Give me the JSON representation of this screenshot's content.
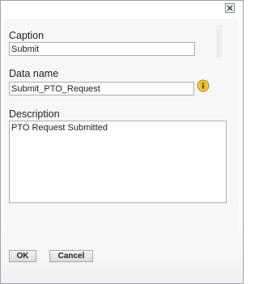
{
  "dialog": {
    "caption": {
      "label": "Caption",
      "value": "Submit"
    },
    "data_name": {
      "label": "Data name",
      "value": "Submit_PTO_Request",
      "info_icon": "info-icon"
    },
    "description": {
      "label": "Description",
      "value": "PTO Request Submitted"
    },
    "buttons": {
      "ok": "OK",
      "cancel": "Cancel"
    },
    "close_icon": "close-icon",
    "colors": {
      "info": "#e8b81f",
      "border": "#9aa3ad"
    }
  }
}
